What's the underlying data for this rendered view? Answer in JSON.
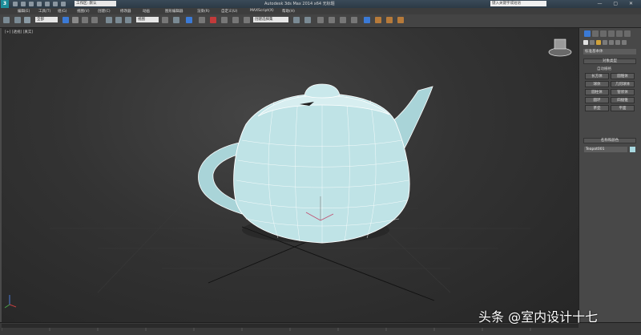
{
  "titlebar": {
    "workspace_value": "工作区: 默认",
    "app_title": "Autodesk 3ds Max 2014 x64    无标题",
    "search_placeholder": "键入关键字或短语",
    "window_controls": "— ▢ ✕"
  },
  "menubar": {
    "items": [
      "编辑(E)",
      "工具(T)",
      "组(G)",
      "视图(V)",
      "创建(C)",
      "修改器",
      "动画",
      "图形编辑器",
      "渲染(R)",
      "自定义(U)",
      "MAXScript(X)",
      "帮助(H)"
    ]
  },
  "toolbar": {
    "selection_filter": "全部",
    "ref_coord": "视图",
    "named_selection": "创建选择集"
  },
  "viewport": {
    "label": "[+] [透视] [真实]",
    "object_color": "#bfe3e6"
  },
  "command_panel": {
    "primitive_type": "标准基本体",
    "object_type_title": "对象类型",
    "autogrid_label": "自动栅格",
    "object_buttons": [
      "长方体",
      "圆锥体",
      "球体",
      "几何球体",
      "圆柱体",
      "管状体",
      "圆环",
      "四棱锥",
      "茶壶",
      "平面"
    ],
    "name_color_title": "名称和颜色",
    "object_name": "Teapot001"
  },
  "watermark": "头条 @室内设计十七"
}
